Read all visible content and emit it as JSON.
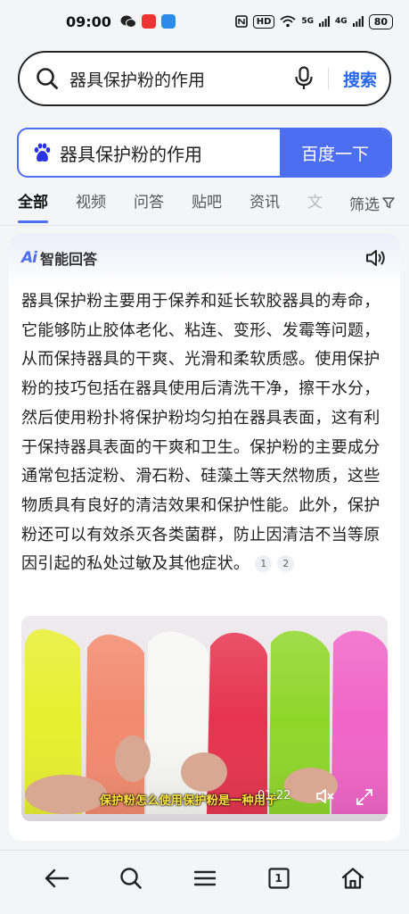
{
  "status_bar": {
    "time": "09:00",
    "network_label": "HD",
    "signal_5g": "5G",
    "signal_4g": "4G",
    "battery": "80"
  },
  "search_bar": {
    "query": "器具保护粉的作用",
    "search_button": "搜索"
  },
  "baidu_box": {
    "query": "器具保护粉的作用",
    "submit_button": "百度一下"
  },
  "tabs": [
    {
      "label": "全部",
      "active": true
    },
    {
      "label": "视频",
      "active": false
    },
    {
      "label": "问答",
      "active": false
    },
    {
      "label": "贴吧",
      "active": false
    },
    {
      "label": "资讯",
      "active": false
    },
    {
      "label": "文",
      "active": false
    }
  ],
  "filter_label": "筛选",
  "ai_answer": {
    "logo": "Ai",
    "title": "智能回答",
    "text": "器具保护粉主要用于保养和延长软胶器具的寿命，它能够防止胶体老化、粘连、变形、发霉等问题，从而保持器具的干爽、光滑和柔软质感。使用保护粉的技巧包括在器具使用后清洗干净，擦干水分，然后使用粉扑将保护粉均匀拍在器具表面，这有利于保持器具表面的干爽和卫生。保护粉的主要成分通常包括淀粉、滑石粉、硅藻土等天然物质，这些物质具有良好的清洁效果和保护性能。此外，保护粉还可以有效杀灭各类菌群，防止因清洁不当等原因引起的私处过敏及其他症状。",
    "refs": [
      "1",
      "2"
    ]
  },
  "video": {
    "caption": "保护粉怎么使用保护粉是一种用于",
    "duration": "01:22",
    "slime_colors": [
      "#e8ef2f",
      "#f28a6e",
      "#f7f7f4",
      "#e6344f",
      "#8fd62a",
      "#f065c8"
    ]
  },
  "colors": {
    "accent": "#4e6ef2",
    "search_link": "#2a66e8"
  },
  "bottom_nav": {
    "tab_count": "1"
  }
}
